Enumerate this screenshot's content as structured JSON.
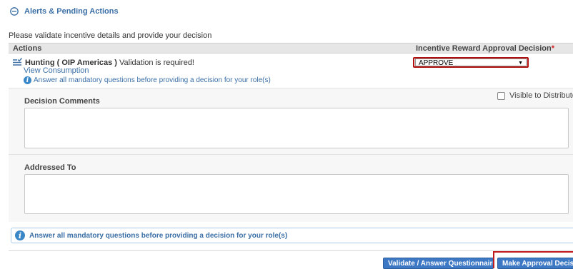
{
  "section": {
    "title": "Alerts & Pending Actions",
    "intro": "Please validate incentive details and provide your decision"
  },
  "table": {
    "col_actions": "Actions",
    "col_decision": "Incentive Reward Approval Decision",
    "required_mark": "*"
  },
  "task": {
    "name": "Hunting ( OIP Americas )",
    "status": " Validation is required!",
    "link": "View Consumption",
    "info": "Answer all mandatory questions before providing a decision for your role(s)"
  },
  "decision": {
    "selected": "APPROVE"
  },
  "comments": {
    "label": "Decision Comments",
    "visible_label": "Visible to Distributor",
    "visible_checked": false
  },
  "addressed": {
    "label": "Addressed To"
  },
  "alert": {
    "text": "Answer all mandatory questions before providing a decision for your role(s)"
  },
  "buttons": {
    "validate": "Validate / Answer Questionnaire",
    "decision": "Make Approval Decision"
  },
  "colors": {
    "link": "#3a6ea5",
    "button": "#3d78c4",
    "highlight": "#c0191e"
  }
}
